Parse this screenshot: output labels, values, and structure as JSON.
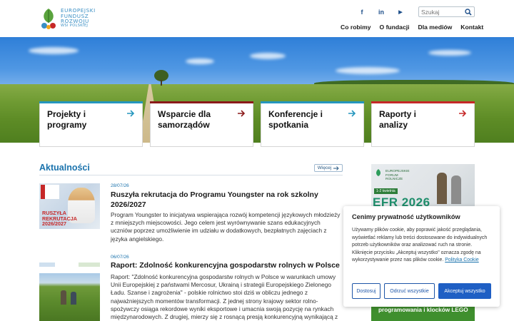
{
  "header": {
    "logo_lines": [
      "EUROPEJSKI",
      "FUNDUSZ",
      "ROZWOJU",
      "WSI POLSKIEJ"
    ],
    "social": [
      {
        "icon": "facebook-icon",
        "glyph": "f"
      },
      {
        "icon": "linkedin-icon",
        "glyph": "in"
      },
      {
        "icon": "youtube-icon",
        "glyph": "▶"
      }
    ],
    "search_placeholder": "Szukaj",
    "nav": [
      "Co robimy",
      "O fundacji",
      "Dla mediów",
      "Kontakt"
    ]
  },
  "cards": [
    {
      "title": "Projekty i programy",
      "color": "#2596be"
    },
    {
      "title": "Wsparcie dla samorządów",
      "color": "#8b1a1a"
    },
    {
      "title": "Konferencje i spotkania",
      "color": "#2596be"
    },
    {
      "title": "Raporty i analizy",
      "color": "#c62828"
    }
  ],
  "news": {
    "heading": "Aktualności",
    "more_label": "Więcej",
    "items": [
      {
        "date": "28/07/26",
        "title": "Ruszyła rekrutacja do Programu Youngster na rok szkolny 2026/2027",
        "body": "Program Youngster to inicjatywa wspierająca rozwój kompetencji językowych młodzieży z mniejszych miejscowości. Jego celem jest wyrównywanie szans edukacyjnych uczniów poprzez umożliwienie im udziału w dodatkowych, bezpłatnych zajęciach z języka angielskiego.",
        "image_caption": "RUSZYŁA REKRUTACJA 2026/2027"
      },
      {
        "date": "06/07/26",
        "title": "Raport: Zdolność konkurencyjna gospodarstw rolnych w Polsce",
        "body": "Raport: \"Zdolność konkurencyjna gospodarstw rolnych w Polsce w warunkach umowy Unii Europejskiej z państwami Mercosur, Ukrainą i strategii Europejskiego Zielonego Ładu. Szanse i zagrożenia\" - polskie rolnictwo stoi dziś w obliczu jednego z najważniejszych momentów transformacji. Z jednej strony krajowy sektor rolno-spożywczy osiąga rekordowe wyniki eksportowe i umacnia swoją pozycję na rynkach międzynarodowych. Z drugiej, mierzy się z rosnącą presją konkurencyjną wynikającą z planowanej liberalizacji handlu z krajami Mercosur i Ukrainą oraz zmianami"
      }
    ]
  },
  "sidebar": {
    "promo_badge": [
      "EUROPEJSKIE",
      "FORUM",
      "ROLNICZE"
    ],
    "promo_date": "1-2 kwietnia",
    "promo_big": "EFR 2026",
    "lego_label": "programowania i klocków LEGO"
  },
  "cookie": {
    "title": "Cenimy prywatność użytkowników",
    "text": "Używamy plików cookie, aby poprawić jakość przeglądania, wyświetlać reklamy lub treści dostosowane do indywidualnych potrzeb użytkowników oraz analizować ruch na stronie. Kliknięcie przycisku „Akceptuj wszystko\" oznacza zgodę na wykorzystywanie przez nas plików cookie.",
    "link": "Polityka Cookie",
    "buttons": {
      "customize": "Dostosuj",
      "reject": "Odrzuć wszystkie",
      "accept": "Akceptuj wszystko"
    }
  }
}
